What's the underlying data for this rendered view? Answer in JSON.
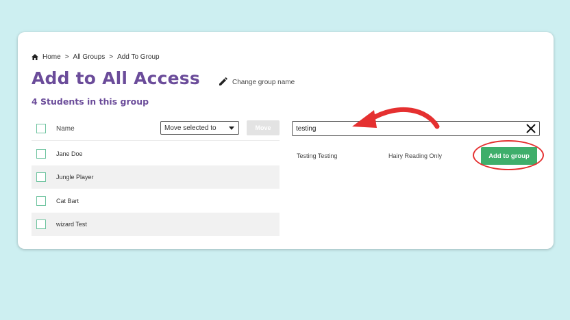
{
  "breadcrumb": {
    "home": "Home",
    "sep1": ">",
    "all_groups": "All Groups",
    "sep2": ">",
    "current": "Add To Group"
  },
  "page": {
    "title": "Add to All Access",
    "change_name_label": "Change group name",
    "subtitle": "4 Students in this group"
  },
  "list": {
    "header_name": "Name",
    "move_select_value": "Move selected to",
    "move_button": "Move",
    "rows": [
      {
        "name": "Jane Doe"
      },
      {
        "name": "Jungle Player"
      },
      {
        "name": "Cat Bart"
      },
      {
        "name": "wizard Test"
      }
    ]
  },
  "search": {
    "value": "testing"
  },
  "result": {
    "student_name": "Testing Testing",
    "group": "Hairy Reading Only",
    "add_button": "Add to group"
  },
  "colors": {
    "background": "#cdeff1",
    "title": "#6b4c9a",
    "add_button": "#3fae6b",
    "annotation": "#e53030",
    "checkbox_border": "#6fc4a0"
  }
}
